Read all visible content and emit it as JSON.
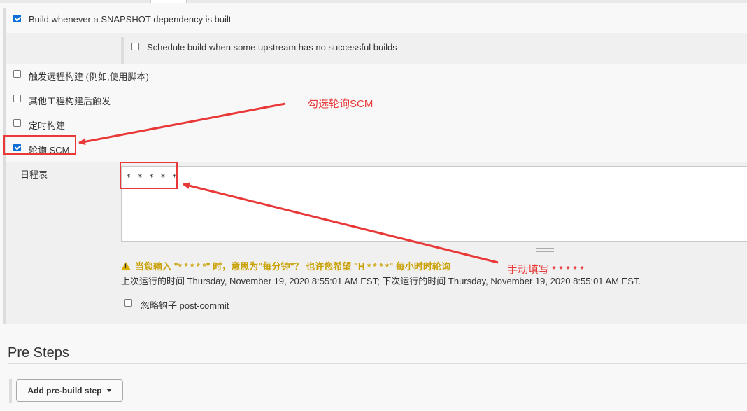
{
  "triggers": {
    "snapshot_label": "Build whenever a SNAPSHOT dependency is built",
    "upstream_label": "Schedule build when some upstream has no successful builds",
    "remote_label": "触发远程构建 (例如,使用脚本)",
    "after_other_label": "其他工程构建后触发",
    "timer_label": "定时构建",
    "poll_scm_label": "轮询 SCM"
  },
  "schedule": {
    "label": "日程表",
    "value": "* * * * *",
    "warning": "当您输入 \"* * * * *\" 时，意思为\"每分钟\"？ 也许您希望 \"H * * * *\" 每小时时轮询",
    "run_info": "上次运行的时间 Thursday, November 19, 2020 8:55:01 AM EST; 下次运行的时间 Thursday, November 19, 2020 8:55:01 AM EST.",
    "ignore_hook_label": "忽略钩子 post-commit"
  },
  "pre_steps": {
    "title": "Pre Steps",
    "add_button": "Add pre-build step"
  },
  "annotations": {
    "poll_note": "勾选轮询SCM",
    "fill_note": "手动填写 * * * * *",
    "color": "#e83838"
  }
}
